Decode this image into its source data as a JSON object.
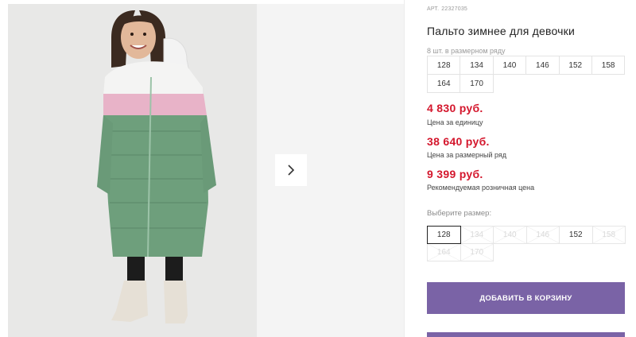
{
  "product": {
    "art_label": "АРТ.",
    "art_number": "22327035",
    "title": "Пальто зимнее для девочки",
    "row_note": "8 шт. в размерном ряду",
    "size_row": [
      [
        "128",
        "134",
        "140",
        "146",
        "152",
        "158"
      ],
      [
        "164",
        "170"
      ]
    ],
    "prices": [
      {
        "value": "4 830 руб.",
        "label": "Цена за единицу"
      },
      {
        "value": "38 640 руб.",
        "label": "Цена за размерный ряд"
      },
      {
        "value": "9 399 руб.",
        "label": "Рекомендуемая розничная цена"
      }
    ],
    "choose_label": "Выберите размер:",
    "choose_sizes": [
      [
        {
          "size": "128",
          "state": "selected"
        },
        {
          "size": "134",
          "state": "disabled"
        },
        {
          "size": "140",
          "state": "disabled"
        },
        {
          "size": "146",
          "state": "disabled"
        },
        {
          "size": "152",
          "state": "available"
        },
        {
          "size": "158",
          "state": "disabled"
        }
      ],
      [
        {
          "size": "164",
          "state": "disabled"
        },
        {
          "size": "170",
          "state": "disabled"
        }
      ]
    ],
    "add_to_cart": "ДОБАВИТЬ В КОРЗИНУ"
  },
  "gallery": {
    "next_icon": "chevron-right-icon"
  },
  "colors": {
    "accent": "#7a63a6",
    "price": "#d4172d",
    "coat_green": "#6e9f7c",
    "coat_pink": "#e8b3c8"
  }
}
